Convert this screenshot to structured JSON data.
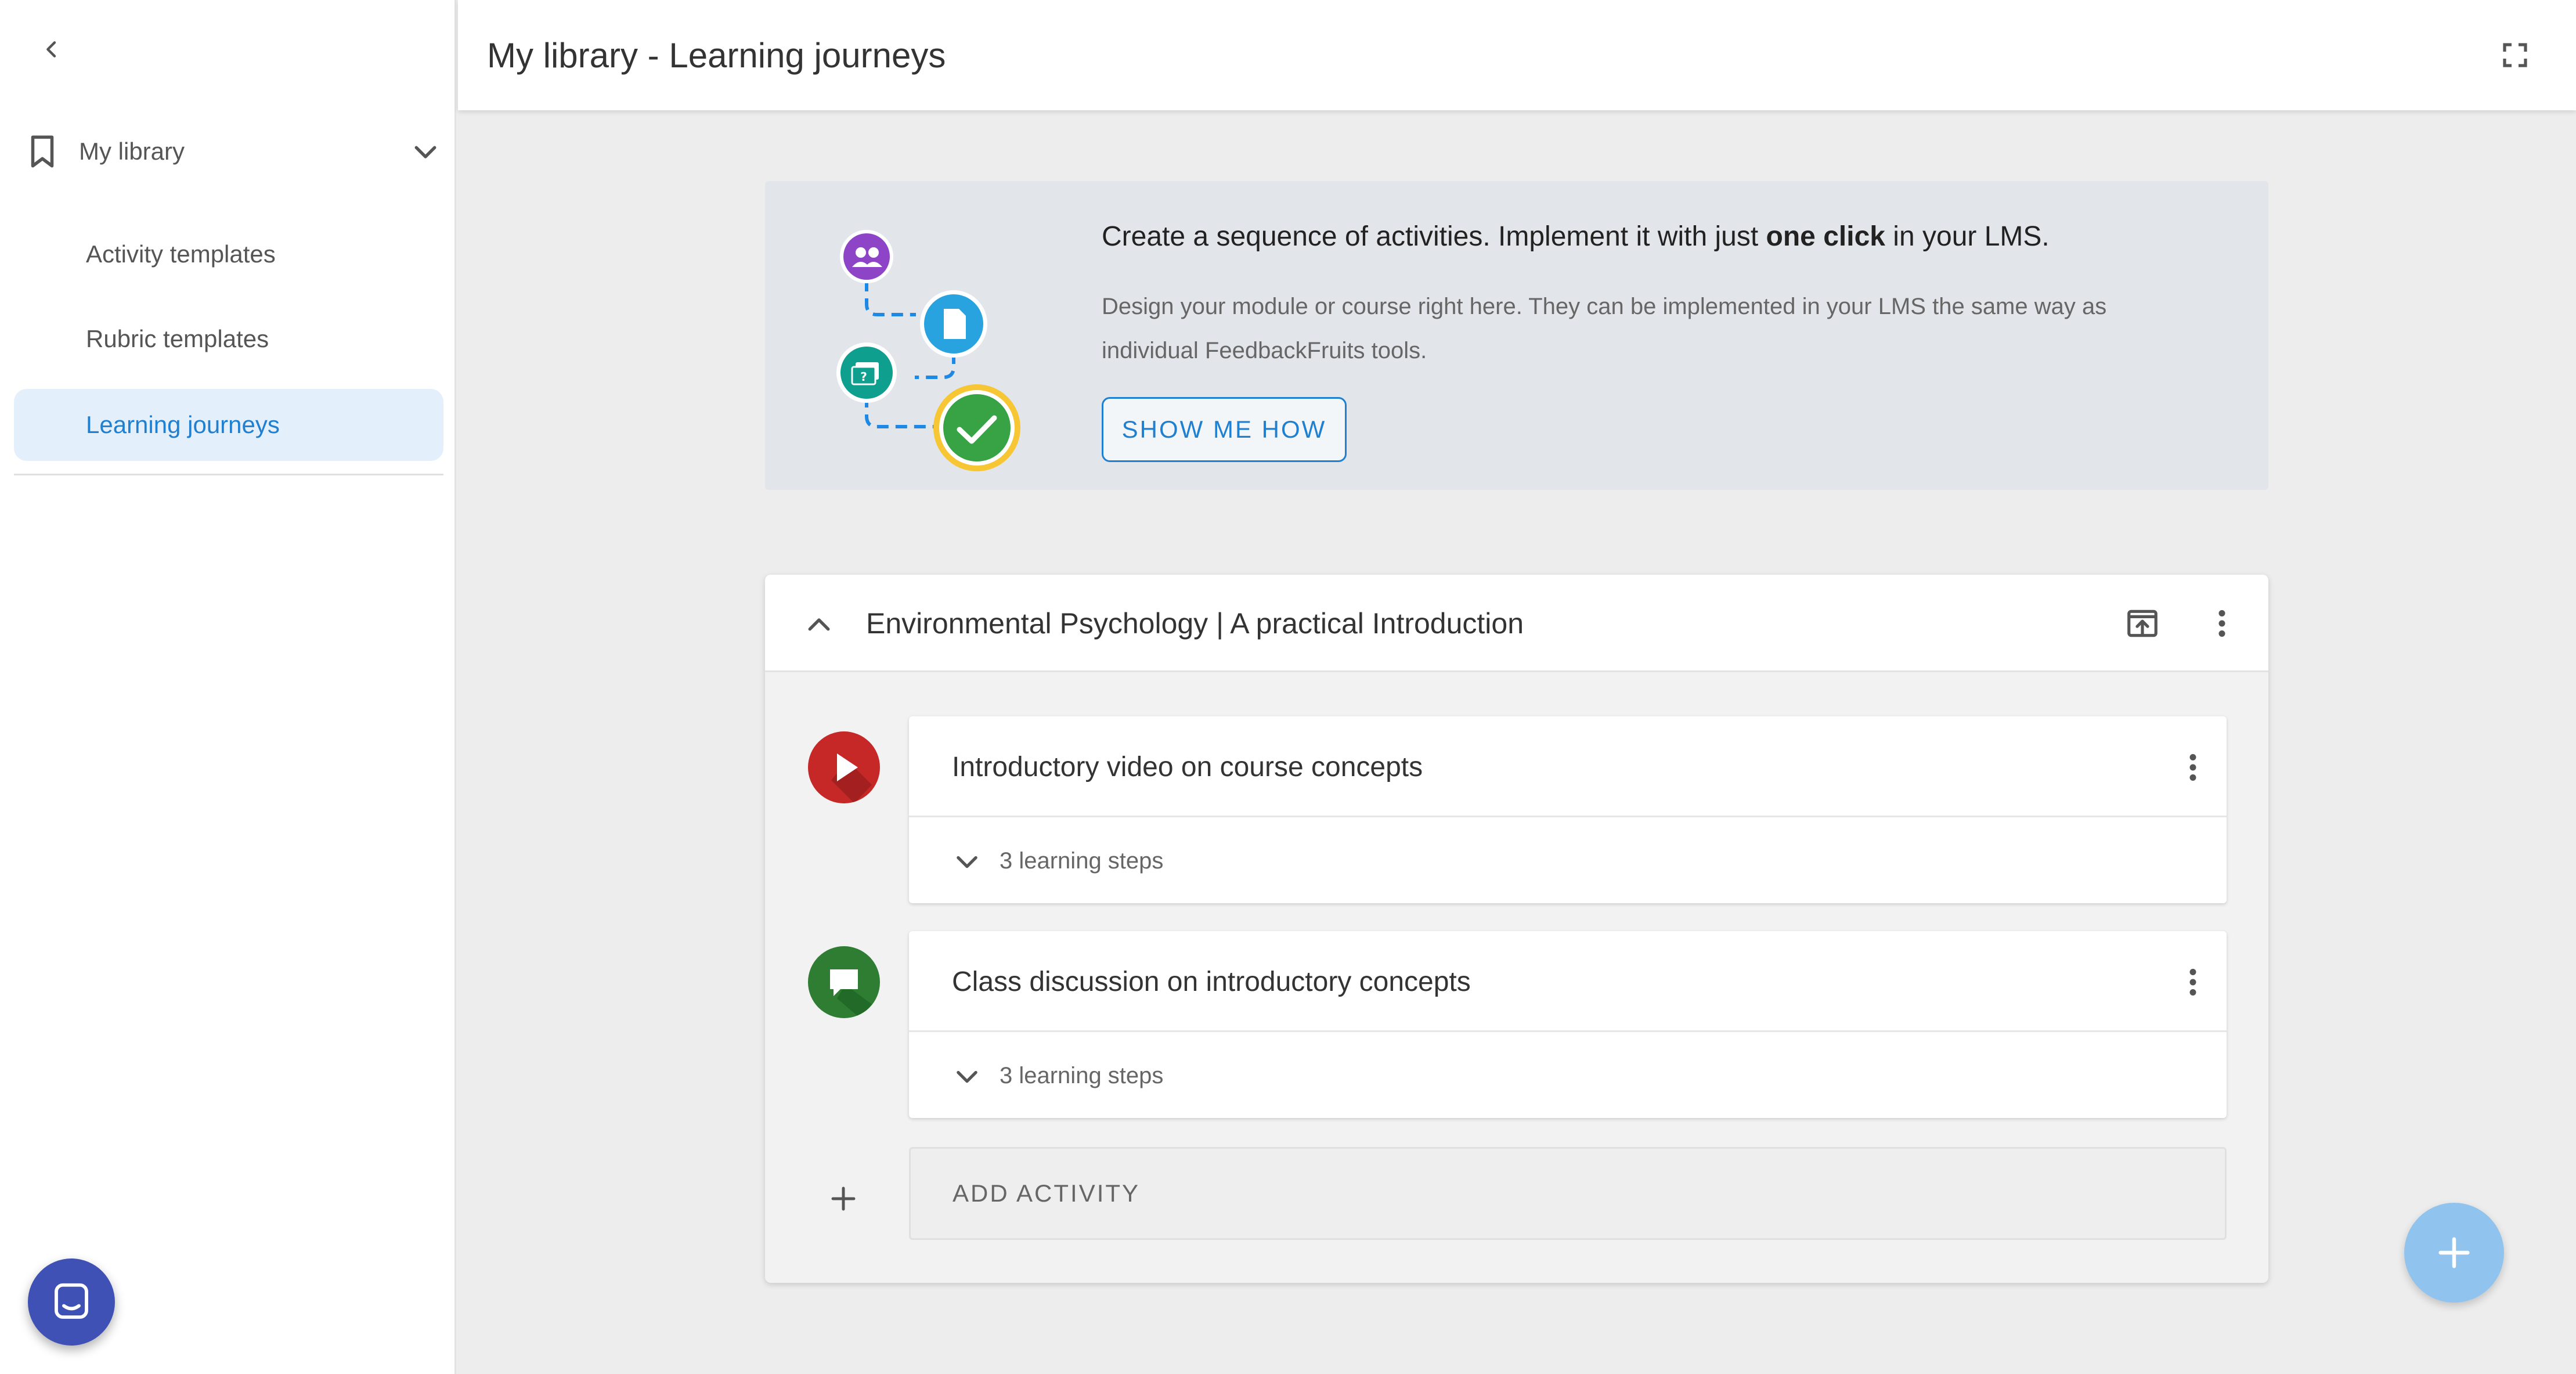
{
  "sidebar": {
    "back_icon": "chevron-left-icon",
    "library": {
      "label": "My library",
      "icon": "bookmark-icon",
      "toggle_icon": "chevron-down-icon"
    },
    "items": [
      {
        "label": "Activity templates",
        "active": false
      },
      {
        "label": "Rubric templates",
        "active": false
      },
      {
        "label": "Learning journeys",
        "active": true
      }
    ],
    "chat_icon": "chat-icon"
  },
  "header": {
    "title": "My library - Learning journeys",
    "fullscreen_icon": "fullscreen-icon"
  },
  "banner": {
    "headline_pre": "Create a sequence of activities. Implement it with just ",
    "headline_bold": "one click",
    "headline_post": " in your LMS.",
    "description": "Design your module or course right here. They can be implemented in your LMS the same way as individual FeedbackFruits tools.",
    "button_label": "SHOW ME HOW"
  },
  "journey": {
    "title": "Environmental Psychology | A practical Introduction",
    "activities": [
      {
        "title": "Introductory video on course concepts",
        "steps_label": "3 learning steps",
        "icon": "play-icon",
        "color": "#c62828"
      },
      {
        "title": "Class discussion on introductory concepts",
        "steps_label": "3 learning steps",
        "icon": "discussion-icon",
        "color": "#2e7d32"
      }
    ],
    "add_activity_label": "ADD ACTIVITY"
  },
  "colors": {
    "accent": "#1f7fd0",
    "active_bg": "#e3effb",
    "fab": "#90c4ef",
    "chat": "#3f51b5"
  }
}
